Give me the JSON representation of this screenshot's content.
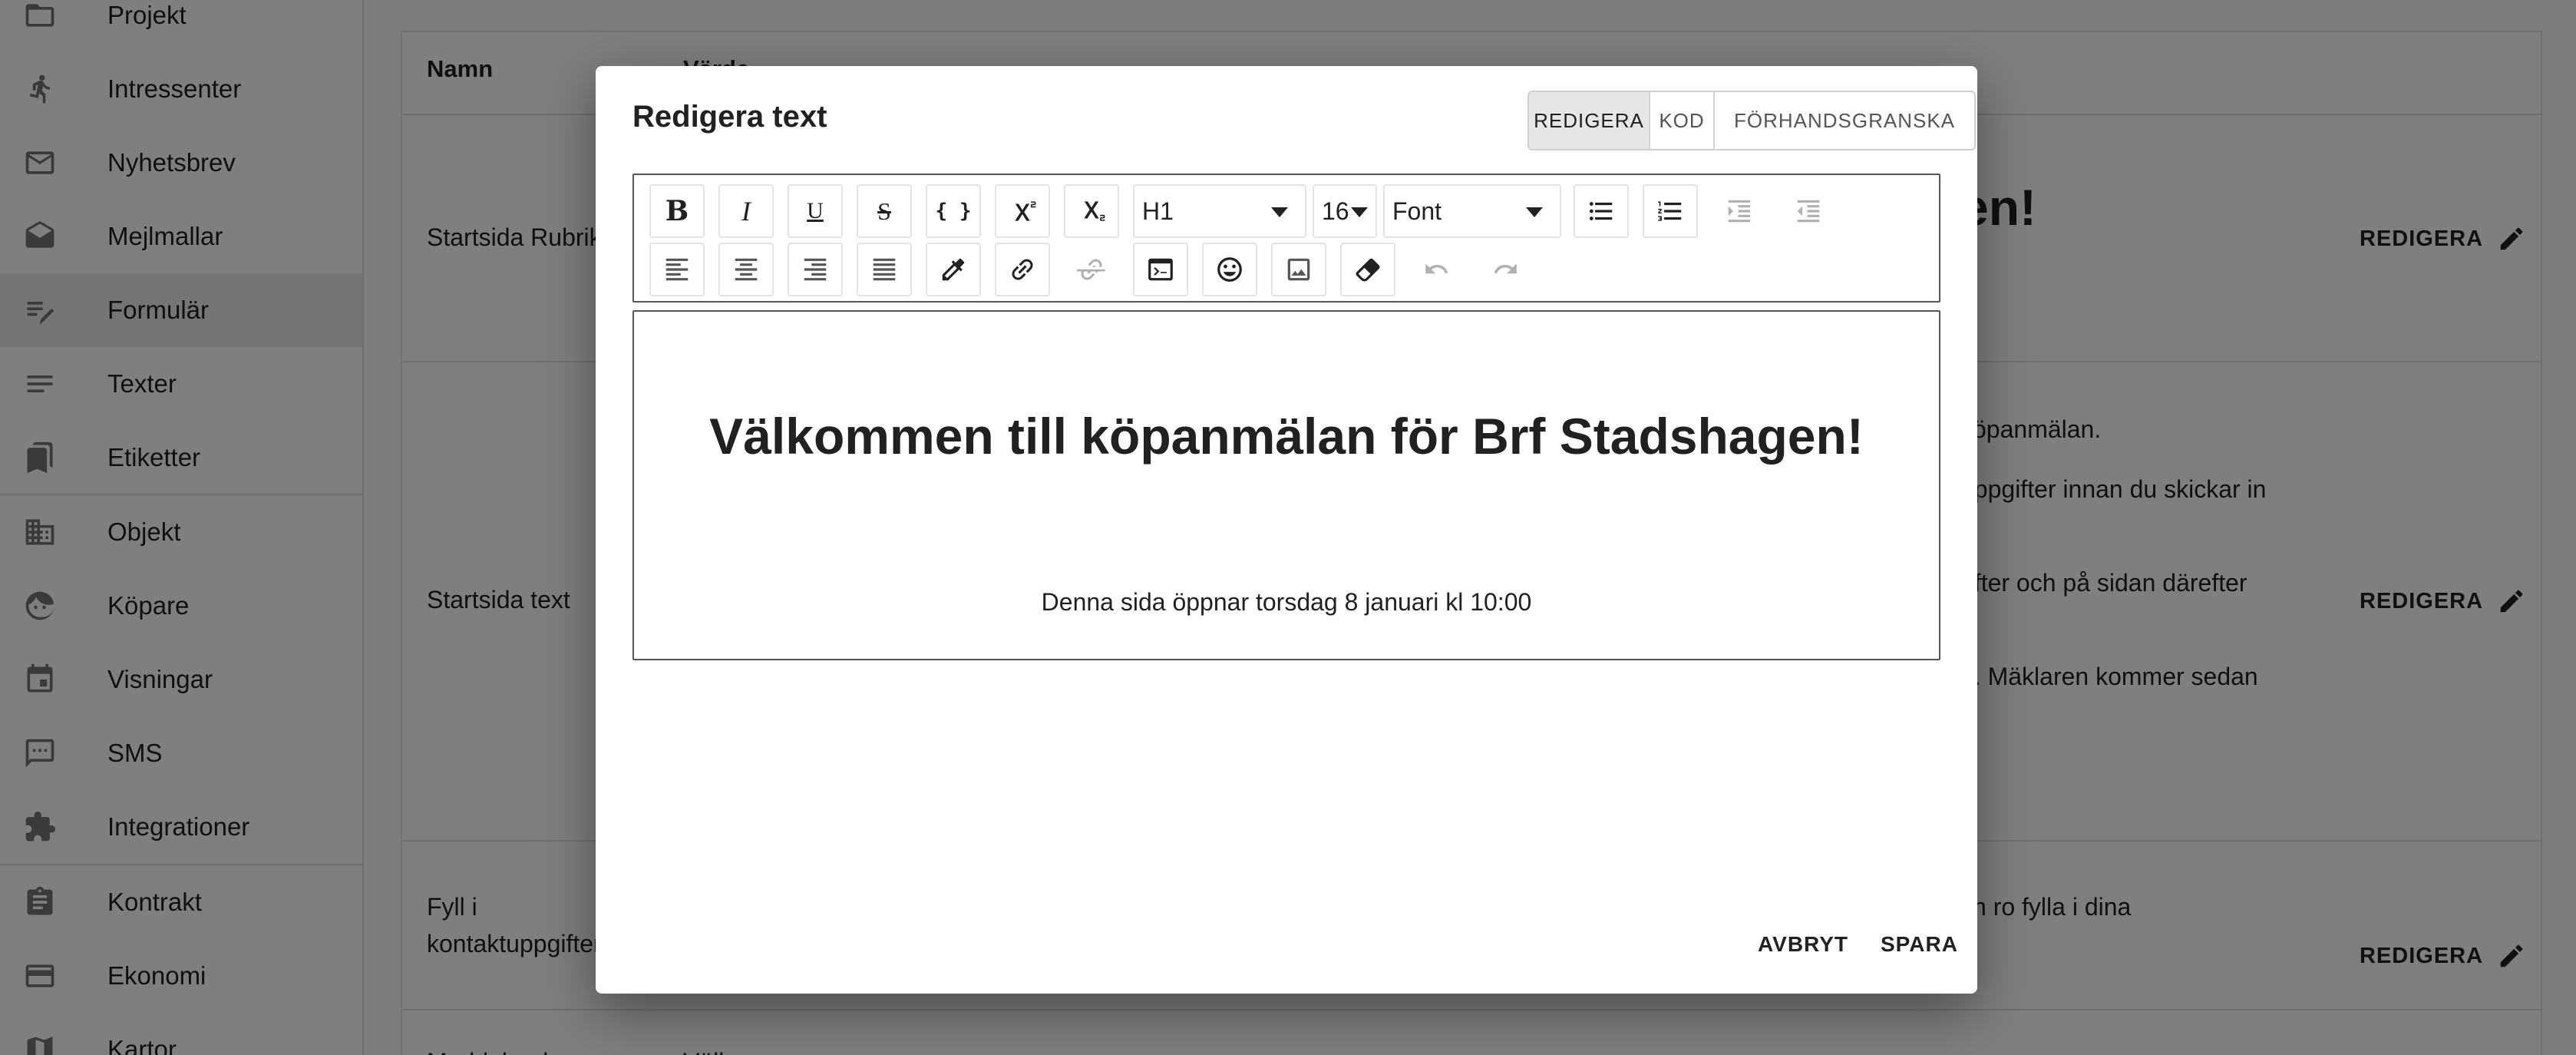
{
  "sidebar": {
    "items": [
      {
        "label": "Projekt",
        "icon": "folder-icon"
      },
      {
        "label": "Intressenter",
        "icon": "person-walking-icon"
      },
      {
        "label": "Nyhetsbrev",
        "icon": "mail-icon"
      },
      {
        "label": "Mejlmallar",
        "icon": "drafts-icon"
      },
      {
        "label": "Formulär",
        "icon": "edit-note-icon"
      },
      {
        "label": "Texter",
        "icon": "notes-icon"
      },
      {
        "label": "Etiketter",
        "icon": "bookmarks-icon"
      },
      {
        "label": "Objekt",
        "icon": "building-icon"
      },
      {
        "label": "Köpare",
        "icon": "face-icon"
      },
      {
        "label": "Visningar",
        "icon": "calendar-icon"
      },
      {
        "label": "SMS",
        "icon": "sms-icon"
      },
      {
        "label": "Integrationer",
        "icon": "puzzle-icon"
      },
      {
        "label": "Kontrakt",
        "icon": "assignment-icon"
      },
      {
        "label": "Ekonomi",
        "icon": "credit-card-icon"
      },
      {
        "label": "Kartor",
        "icon": "map-icon"
      }
    ],
    "active_index": 4
  },
  "table": {
    "headers": {
      "name": "Namn",
      "value": "Värde"
    },
    "rows": [
      {
        "name": "Startsida Rubrik",
        "value": "en!"
      },
      {
        "name": "Startsida text",
        "value_lines": [
          "köpanmälan.",
          "uppgifter innan du skickar in",
          "efter och på sidan därefter",
          "n. Mäklaren kommer sedan"
        ]
      },
      {
        "name_lines": [
          "Fyll i",
          "kontaktuppgifter"
        ],
        "value": "ch ro fylla i dina"
      },
      {
        "name": "Meddelande",
        "value": "Välkommen..."
      }
    ],
    "edit_label": "REDIGERA"
  },
  "dialog": {
    "title": "Redigera text",
    "modes": [
      "REDIGERA",
      "KOD",
      "FÖRHANDSGRANSKA"
    ],
    "active_mode": "REDIGERA",
    "toolbar": {
      "bold": "B",
      "italic": "I",
      "underline": "U",
      "strikethrough": "S",
      "code": "{ }",
      "block_format": "H1",
      "font_size": "16",
      "font_family": "Font"
    },
    "content": {
      "heading": "Välkommen till köpanmälan för Brf Stadshagen!",
      "paragraph": "Denna sida öppnar torsdag 8 januari kl 10:00"
    },
    "cancel_label": "AVBRYT",
    "save_label": "SPARA"
  }
}
